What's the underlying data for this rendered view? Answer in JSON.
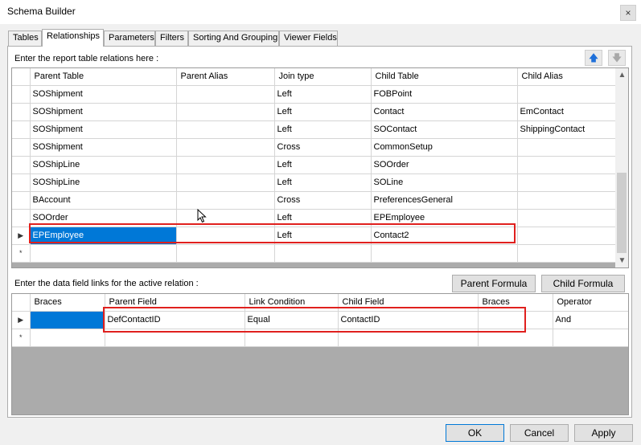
{
  "window": {
    "title": "Schema Builder",
    "close_glyph": "×"
  },
  "tabs": [
    {
      "label": "Tables",
      "active": false
    },
    {
      "label": "Relationships",
      "active": true
    },
    {
      "label": "Parameters",
      "active": false
    },
    {
      "label": "Filters",
      "active": false
    },
    {
      "label": "Sorting And Grouping",
      "active": false
    },
    {
      "label": "Viewer Fields",
      "active": false
    }
  ],
  "relations": {
    "caption": "Enter the report table relations here :",
    "up_icon": "up-arrow-icon",
    "down_icon": "down-arrow-icon",
    "columns": [
      "Parent Table",
      "Parent Alias",
      "Join type",
      "Child Table",
      "Child Alias"
    ],
    "rows": [
      {
        "parent_table": "SOShipment",
        "parent_alias": "",
        "join_type": "Left",
        "child_table": "FOBPoint",
        "child_alias": ""
      },
      {
        "parent_table": "SOShipment",
        "parent_alias": "",
        "join_type": "Left",
        "child_table": "Contact",
        "child_alias": "EmContact"
      },
      {
        "parent_table": "SOShipment",
        "parent_alias": "",
        "join_type": "Left",
        "child_table": "SOContact",
        "child_alias": "ShippingContact"
      },
      {
        "parent_table": "SOShipment",
        "parent_alias": "",
        "join_type": "Cross",
        "child_table": "CommonSetup",
        "child_alias": ""
      },
      {
        "parent_table": "SOShipLine",
        "parent_alias": "",
        "join_type": "Left",
        "child_table": "SOOrder",
        "child_alias": ""
      },
      {
        "parent_table": "SOShipLine",
        "parent_alias": "",
        "join_type": "Left",
        "child_table": "SOLine",
        "child_alias": ""
      },
      {
        "parent_table": "BAccount",
        "parent_alias": "",
        "join_type": "Cross",
        "child_table": "PreferencesGeneral",
        "child_alias": ""
      },
      {
        "parent_table": "SOOrder",
        "parent_alias": "",
        "join_type": "Left",
        "child_table": "EPEmployee",
        "child_alias": ""
      },
      {
        "parent_table": "EPEmployee",
        "parent_alias": "",
        "join_type": "Left",
        "child_table": "Contact2",
        "child_alias": ""
      }
    ],
    "current_row_glyph": "▶",
    "new_row_glyph": "*"
  },
  "links": {
    "caption": "Enter the data field links for the active relation :",
    "parent_formula_label": "Parent Formula",
    "child_formula_label": "Child Formula",
    "columns": [
      "Braces",
      "Parent Field",
      "Link Condition",
      "Child Field",
      "Braces",
      "Operator"
    ],
    "rows": [
      {
        "braces_open": "",
        "parent_field": "DefContactID",
        "link_condition": "Equal",
        "child_field": "ContactID",
        "braces_close": "",
        "operator": "And"
      }
    ],
    "current_row_glyph": "▶",
    "new_row_glyph": "*"
  },
  "footer": {
    "ok_label": "OK",
    "cancel_label": "Cancel",
    "apply_label": "Apply"
  },
  "colors": {
    "selection": "#0078d7",
    "highlight": "#e0201e"
  }
}
